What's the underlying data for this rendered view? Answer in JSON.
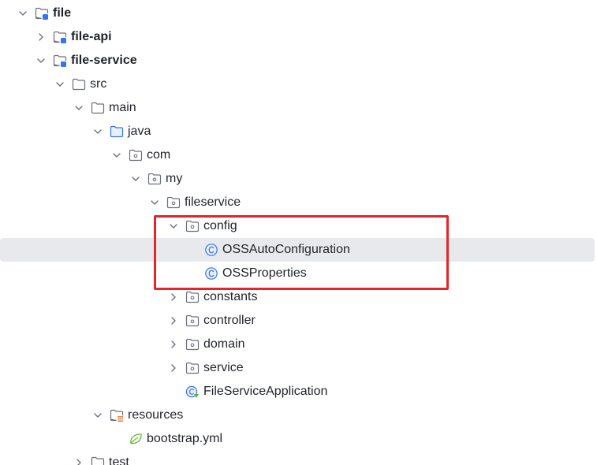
{
  "tree": {
    "file": "file",
    "file_api": "file-api",
    "file_service": "file-service",
    "src": "src",
    "main": "main",
    "java": "java",
    "com": "com",
    "my": "my",
    "fileservice": "fileservice",
    "config": "config",
    "oss_auto_configuration": "OSSAutoConfiguration",
    "oss_properties": "OSSProperties",
    "constants": "constants",
    "controller": "controller",
    "domain": "domain",
    "service": "service",
    "file_service_application": "FileServiceApplication",
    "resources": "resources",
    "bootstrap_yml": "bootstrap.yml",
    "test": "test"
  },
  "colors": {
    "selection_background": "#e8e9ed",
    "highlight_border": "#e5252a",
    "class_icon": "#3574f0",
    "folder_icon": "#6c707e",
    "module_badge": "#3574f0",
    "resources_badge": "#e08855",
    "yml_icon": "#5fb832"
  },
  "icons": {
    "expanded": "chevron-down-icon",
    "collapsed": "chevron-right-icon",
    "module": "module-folder-icon",
    "folder": "folder-icon",
    "source_root": "source-root-folder-icon",
    "package": "package-icon",
    "class": "class-icon",
    "spring_boot_app": "spring-boot-class-icon",
    "resources": "resources-folder-icon",
    "yml": "spring-yml-icon"
  }
}
